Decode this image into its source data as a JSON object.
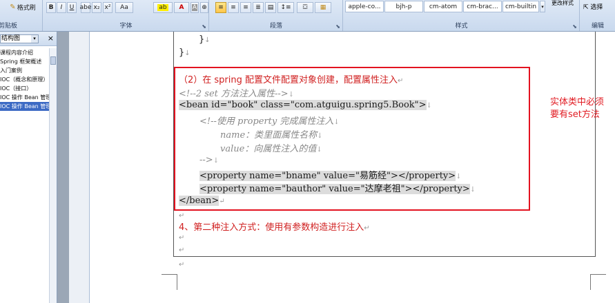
{
  "ribbon": {
    "format_painter": "格式刷",
    "clipboard_label": "剪贴板",
    "font_label": "字体",
    "paragraph_label": "段落",
    "styles_label": "样式",
    "editing_label": "编辑",
    "change_styles": "更改样式",
    "select_label": "选择",
    "font_buttons": [
      "B",
      "I",
      "U",
      "abe",
      "x₂",
      "x²",
      "Aa",
      "A",
      "A"
    ],
    "styles": [
      "apple-co...",
      "bjh-p",
      "cm-atom",
      "cm-brac...",
      "cm-builtin"
    ]
  },
  "nav": {
    "view_select": "结构图",
    "close": "×",
    "items": [
      {
        "label": "课程内容介绍",
        "selected": false
      },
      {
        "label": "Spring 框架概述",
        "selected": false
      },
      {
        "label": "入门案例",
        "selected": false
      },
      {
        "label": "IOC（概念和原理）",
        "selected": false
      },
      {
        "label": "IOC（接口）",
        "selected": false
      },
      {
        "label": "IOC 操作 Bean 管理（",
        "selected": false
      },
      {
        "label": "IOC 操作 Bean 管理（",
        "selected": true
      }
    ]
  },
  "doc": {
    "top_brace_1": "}",
    "top_brace_2": "}",
    "heading_2": "（2）在 spring 配置文件配置对象创建，配置属性注入",
    "comment_set": "<!--2 set 方法注入属性-->",
    "bean_open": "<bean id=\"book\" class=\"com.atguigu.spring5.Book\">",
    "comment_property": "<!--使用 property 完成属性注入",
    "comment_name": "name：类里面属性名称",
    "comment_value": "value：向属性注入的值",
    "comment_close": "-->",
    "property_1": "<property name=\"bname\" value=\"易筋经\"></property>",
    "property_2": "<property name=\"bauthor\" value=\"达摩老祖\"></property>",
    "bean_close": "</bean>",
    "heading_4": "4、第二种注入方式：使用有参数构造进行注入"
  },
  "annotation": {
    "text": "实体类中必须要有set方法"
  },
  "colors": {
    "red_box": "#e3121f",
    "heading_red": "#d02020",
    "selection_blue": "#3c6ac4"
  }
}
